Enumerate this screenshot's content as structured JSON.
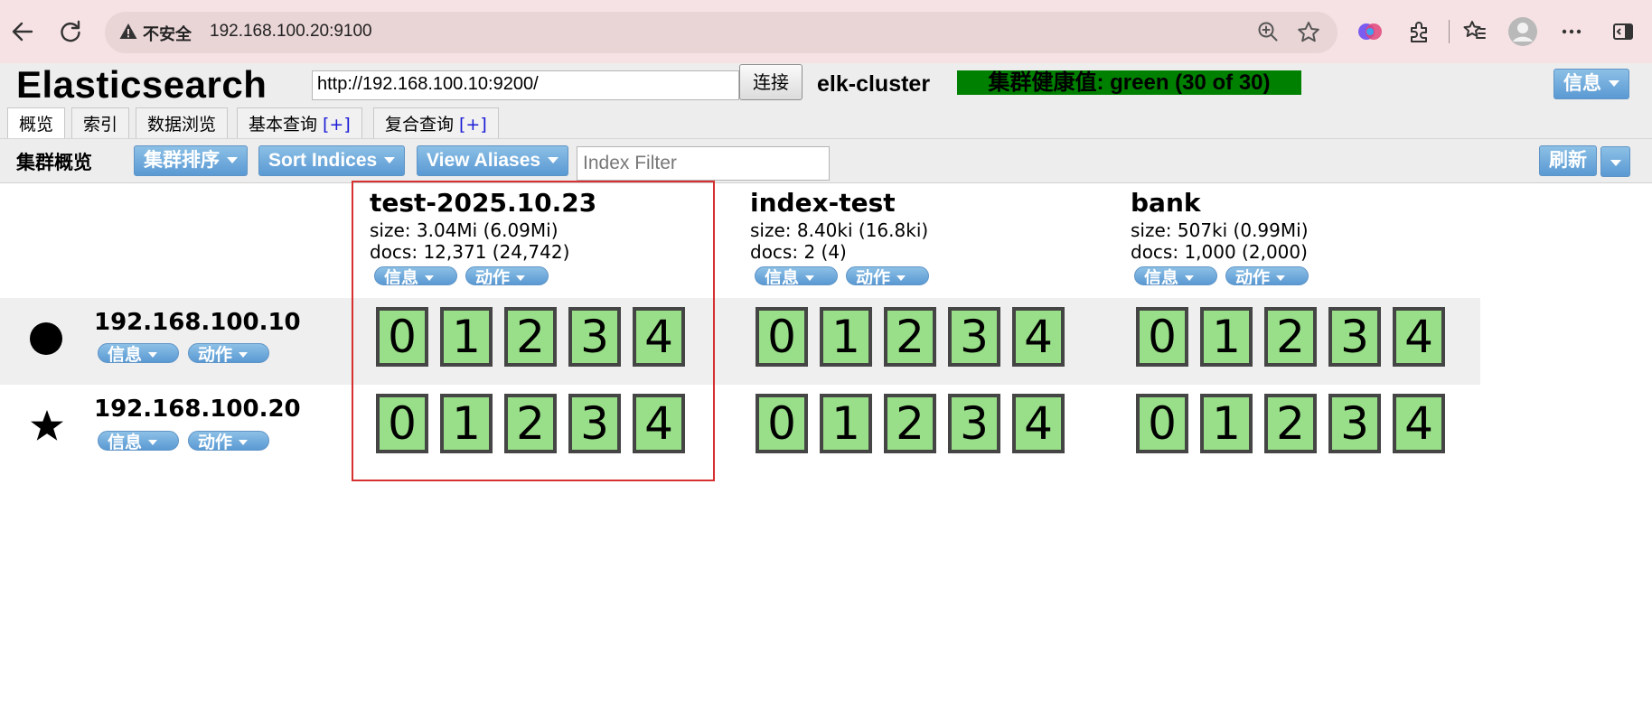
{
  "browser": {
    "security_label": "不安全",
    "url": "192.168.100.20:9100"
  },
  "app": {
    "title": "Elasticsearch",
    "connection_url": "http://192.168.100.10:9200/",
    "connect_label": "连接",
    "cluster_name": "elk-cluster",
    "health_text": "集群健康值: green (30 of 30)",
    "health_color": "#008000",
    "info_label": "信息",
    "tabs": [
      {
        "label": "概览",
        "plus": ""
      },
      {
        "label": "索引",
        "plus": ""
      },
      {
        "label": "数据浏览",
        "plus": ""
      },
      {
        "label": "基本查询",
        "plus": "[+]"
      },
      {
        "label": "复合查询",
        "plus": "[+]"
      }
    ]
  },
  "toolbar": {
    "overview_label": "集群概览",
    "sort_cluster_label": "集群排序",
    "sort_indices_label": "Sort Indices",
    "view_aliases_label": "View Aliases",
    "index_filter_placeholder": "Index Filter",
    "refresh_label": "刷新"
  },
  "pill_labels": {
    "info": "信息",
    "action": "动作"
  },
  "indices": [
    {
      "name": "test-2025.10.23",
      "size": "size: 3.04Mi (6.09Mi)",
      "docs": "docs: 12,371 (24,742)"
    },
    {
      "name": "index-test",
      "size": "size: 8.40ki (16.8ki)",
      "docs": "docs: 2 (4)"
    },
    {
      "name": "bank",
      "size": "size: 507ki (0.99Mi)",
      "docs": "docs: 1,000 (2,000)"
    }
  ],
  "nodes": [
    {
      "ip": "192.168.100.10",
      "icon": "circle-icon"
    },
    {
      "ip": "192.168.100.20",
      "icon": "star-icon"
    }
  ],
  "shards": [
    "0",
    "1",
    "2",
    "3",
    "4"
  ],
  "colors": {
    "shard_fill": "#99de88",
    "highlight": "#d63030",
    "button": "#5a99d3"
  }
}
